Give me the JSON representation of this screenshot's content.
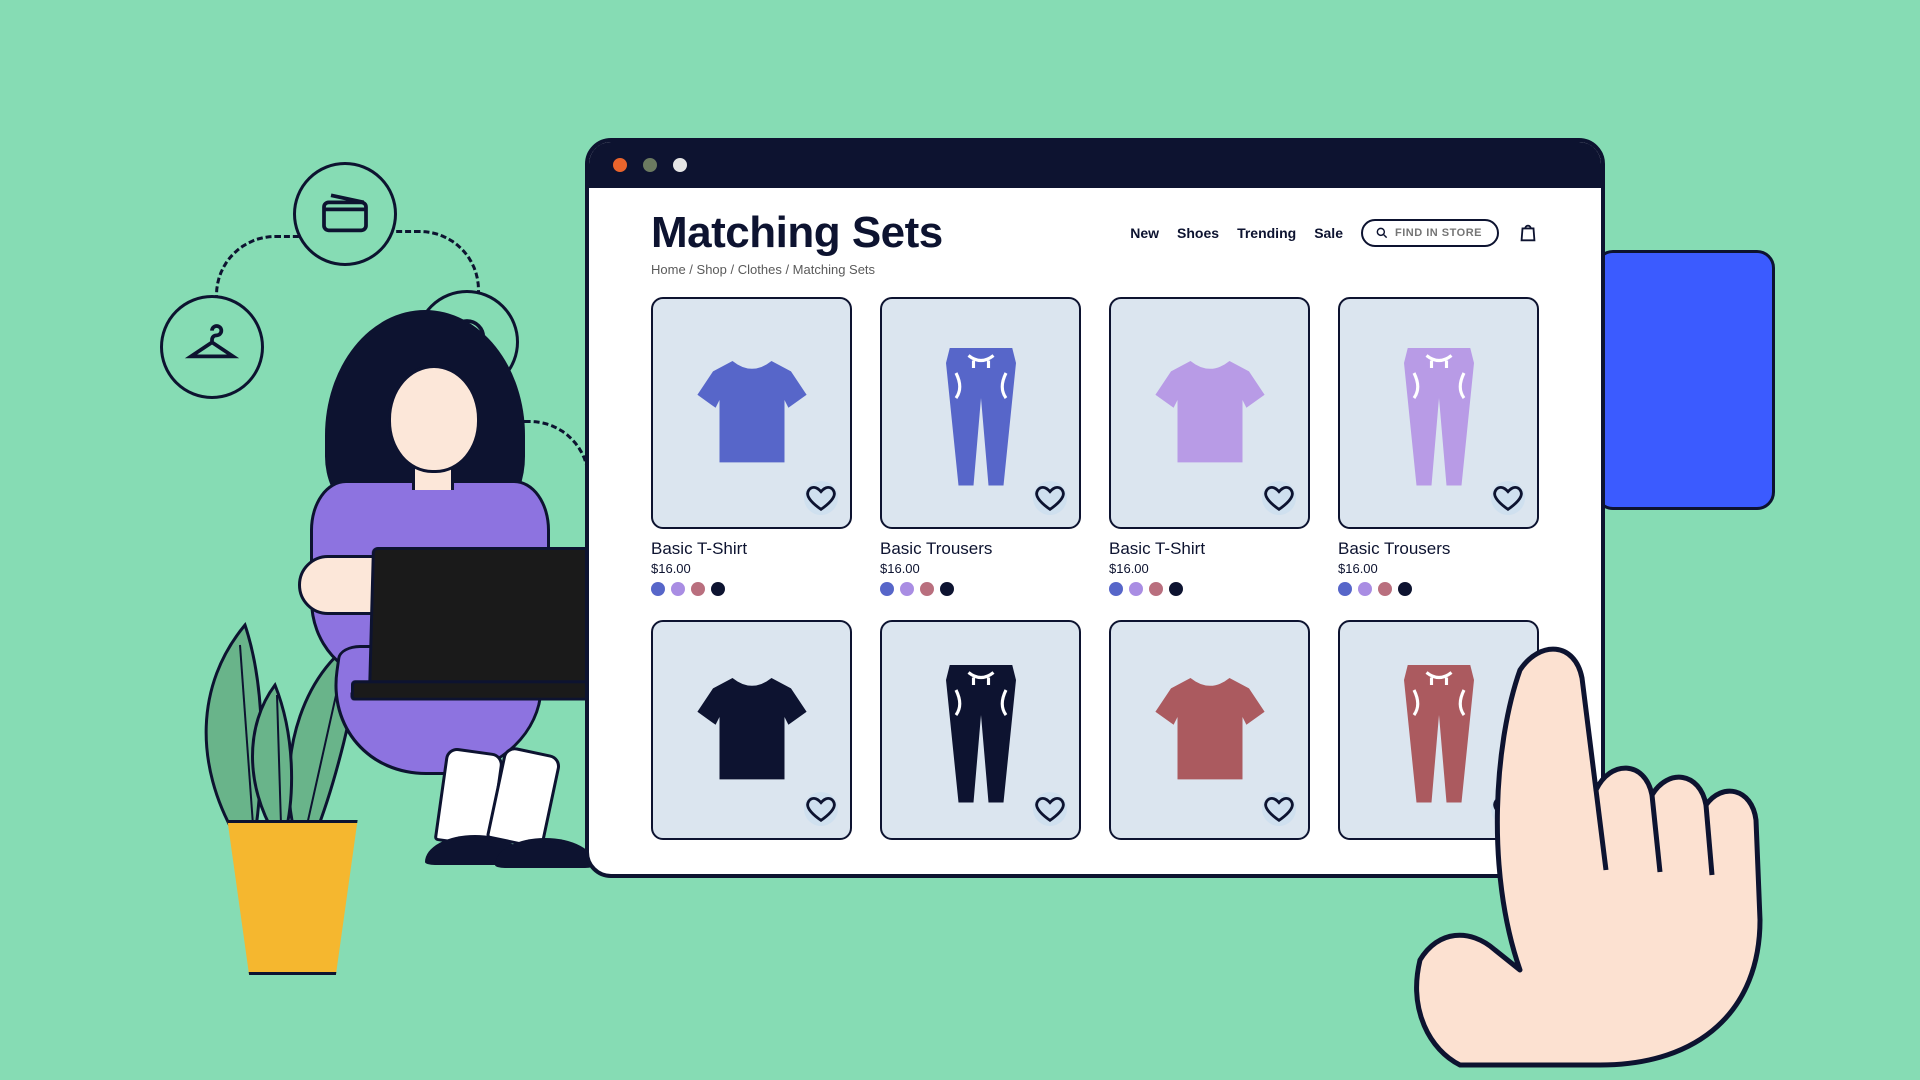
{
  "header": {
    "title": "Matching Sets",
    "nav": [
      "New",
      "Shoes",
      "Trending",
      "Sale"
    ],
    "search_placeholder": "FIND IN STORE"
  },
  "breadcrumb": [
    "Home",
    "Shop",
    "Clothes",
    "Matching Sets"
  ],
  "swatch_colors": [
    "#5766c9",
    "#a98de3",
    "#b96f7e",
    "#0d1330"
  ],
  "products_row1": [
    {
      "name": "Basic T-Shirt",
      "price": "$16.00",
      "kind": "tshirt",
      "color": "#5766c9"
    },
    {
      "name": "Basic Trousers",
      "price": "$16.00",
      "kind": "trousers",
      "color": "#5766c9"
    },
    {
      "name": "Basic T-Shirt",
      "price": "$16.00",
      "kind": "tshirt",
      "color": "#b89be6"
    },
    {
      "name": "Basic Trousers",
      "price": "$16.00",
      "kind": "trousers",
      "color": "#b89be6"
    }
  ],
  "products_row2": [
    {
      "name": "",
      "price": "",
      "kind": "tshirt",
      "color": "#0d1330"
    },
    {
      "name": "",
      "price": "",
      "kind": "trousers",
      "color": "#0d1330"
    },
    {
      "name": "",
      "price": "",
      "kind": "tshirt",
      "color": "#ab5a5f"
    },
    {
      "name": "",
      "price": "",
      "kind": "trousers",
      "color": "#ab5a5f"
    }
  ]
}
